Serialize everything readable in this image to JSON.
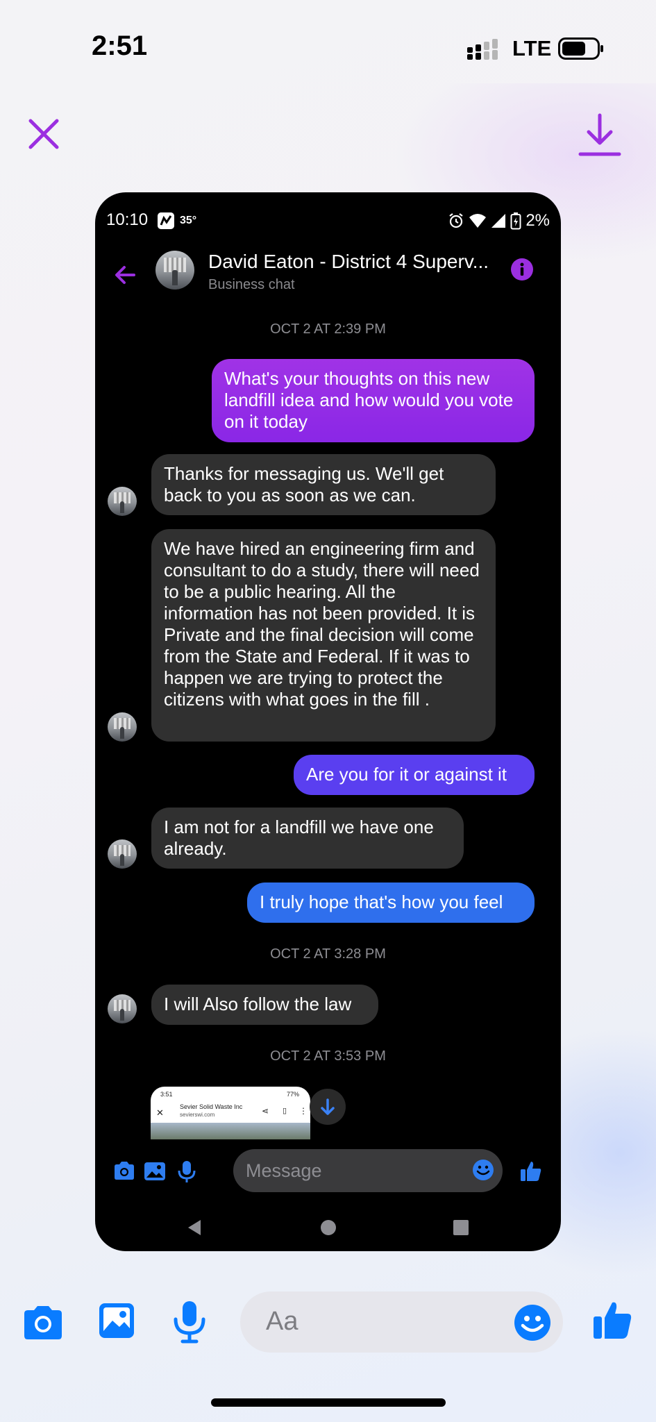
{
  "ios_status": {
    "time": "2:51",
    "network": "LTE"
  },
  "top_bar": {
    "close_icon": "close-icon",
    "download_icon": "download-icon"
  },
  "android_status": {
    "time": "10:10",
    "temperature": "35°",
    "battery": "2%"
  },
  "chat_header": {
    "name": "David Eaton - District 4 Superv...",
    "subtitle": "Business chat"
  },
  "messages": [
    {
      "type": "timestamp",
      "text": "OCT 2 AT 2:39 PM"
    },
    {
      "type": "outgoing",
      "text": "What's your thoughts on this new landfill idea and how would you vote on it today"
    },
    {
      "type": "incoming",
      "text": "Thanks for messaging us. We'll get back to you as soon as we can."
    },
    {
      "type": "incoming",
      "text": "We have hired an engineering firm and consultant to do a study, there will need to be a public hearing. All the information has not been provided. It is Private and the final decision will come from the State and Federal. If it was to happen we are trying to protect the citizens with what goes in the fill ."
    },
    {
      "type": "outgoing",
      "text": "Are you for it or against it"
    },
    {
      "type": "incoming",
      "text": "I am not for a landfill we have one already."
    },
    {
      "type": "outgoing",
      "text": "I truly hope that's how you feel"
    },
    {
      "type": "timestamp",
      "text": "OCT 2 AT 3:28 PM"
    },
    {
      "type": "incoming",
      "text": "I will Also follow the law"
    },
    {
      "type": "timestamp",
      "text": "OCT 2 AT 3:53 PM"
    }
  ],
  "attachment": {
    "time": "3:51",
    "battery": "77%",
    "site_title": "Sevier Solid Waste Inc",
    "site_url": "sevierswi.com"
  },
  "inner_composer": {
    "placeholder": "Message"
  },
  "outer_composer": {
    "placeholder": "Aa"
  },
  "colors": {
    "accent_purple": "#9b2fe0",
    "messenger_blue": "#0a7cff",
    "outgoing_gradient": [
      "#a033e6",
      "#2f6fed"
    ],
    "incoming_bubble": "#303030"
  }
}
